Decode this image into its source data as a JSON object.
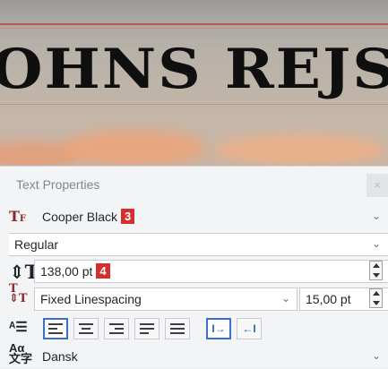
{
  "canvas": {
    "banner_text": "OHNS REJSE"
  },
  "panel": {
    "title": "Text Properties",
    "close_glyph": "×",
    "font_family": {
      "value": "Cooper Black",
      "badge": "3"
    },
    "font_style": {
      "value": "Regular"
    },
    "font_size": {
      "value": "138,00 pt",
      "badge": "4"
    },
    "line_spacing": {
      "mode": "Fixed Linespacing",
      "value": "15,00 pt"
    },
    "alignment": {
      "options": [
        "align-left",
        "align-center",
        "align-right",
        "justify",
        "force-justify"
      ],
      "selected": "align-left"
    },
    "direction": {
      "options": [
        "left-to-right",
        "right-to-left"
      ],
      "selected": "left-to-right"
    },
    "language": {
      "value": "Dansk"
    },
    "icons": {
      "font_family": "font-family-icon",
      "font_size": "font-size-icon",
      "line_spacing": "line-spacing-icon",
      "alignment": "alignment-icon",
      "language": "language-icon"
    },
    "colors": {
      "accent": "#3b6fcf",
      "badge": "#d32f2f"
    }
  }
}
